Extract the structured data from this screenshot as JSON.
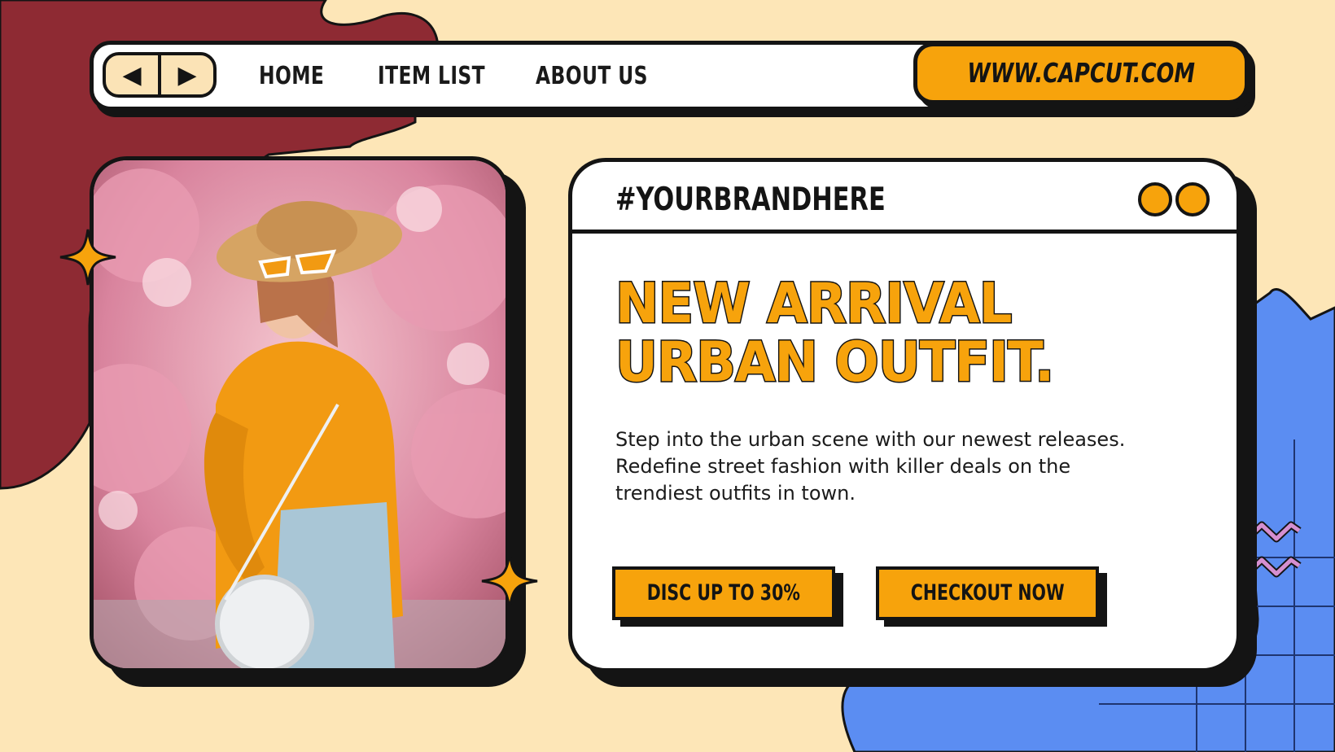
{
  "nav": {
    "back_icon": "back-arrow-icon",
    "forward_icon": "forward-arrow-icon",
    "back_glyph": "◀",
    "forward_glyph": "▶",
    "links": [
      "HOME",
      "ITEM LIST",
      "ABOUT US"
    ],
    "url": "WWW.CAPCUT.COM"
  },
  "card": {
    "brand": "#YOURBRANDHERE",
    "headline_line1": "NEW ARRIVAL",
    "headline_line2": "URBAN OUTFIT.",
    "body_lines": [
      "Step into the urban scene with our newest releases.",
      "Redefine street fashion with killer deals on the",
      "trendiest outfits in town."
    ],
    "buttons": [
      "DISC UP TO 30%",
      "CHECKOUT NOW"
    ]
  },
  "colors": {
    "accent": "#F7A30C",
    "maroon": "#8E2A33",
    "blue": "#5B8DF2",
    "cream": "#FDE6B7",
    "ink": "#141414",
    "zigzag": "#D58FD0"
  }
}
